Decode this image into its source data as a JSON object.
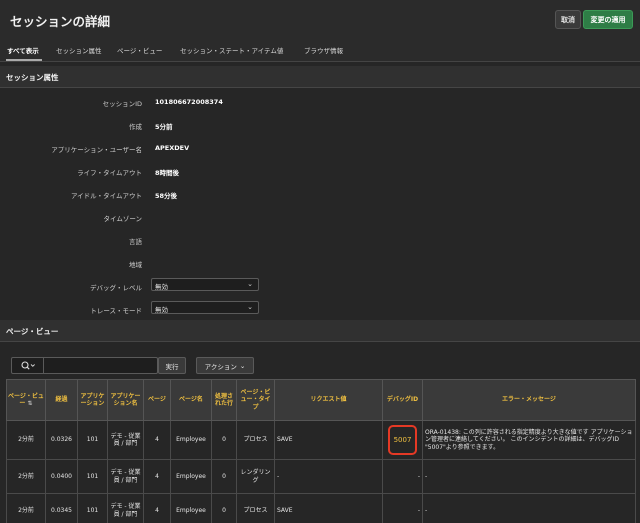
{
  "header": {
    "title": "セッションの詳細",
    "cancel_label": "取消",
    "apply_label": "変更の適用"
  },
  "tabs": [
    {
      "label": "すべて表示"
    },
    {
      "label": "セッション属性"
    },
    {
      "label": "ページ・ビュー"
    },
    {
      "label": "セッション・ステート・アイテム値"
    },
    {
      "label": "ブラウザ情報"
    }
  ],
  "session": {
    "section_title": "セッション属性",
    "attributes": [
      {
        "label": "セッションID",
        "value": "101806672008374"
      },
      {
        "label": "作成",
        "value": "5分前"
      },
      {
        "label": "アプリケーション・ユーザー名",
        "value": "APEXDEV"
      },
      {
        "label": "ライフ・タイムアウト",
        "value": "8時間後"
      },
      {
        "label": "アイドル・タイムアウト",
        "value": "58分後"
      },
      {
        "label": "タイムゾーン",
        "value": ""
      },
      {
        "label": "言語",
        "value": ""
      },
      {
        "label": "地域",
        "value": ""
      }
    ],
    "debug_level": {
      "label": "デバッグ・レベル",
      "value": "無効"
    },
    "trace_mode": {
      "label": "トレース・モード",
      "value": "無効"
    }
  },
  "page_views": {
    "section_title": "ページ・ビュー",
    "search": {
      "placeholder": ""
    },
    "go_label": "実行",
    "actions_label": "アクション",
    "columns": [
      "ページ・ビュー",
      "経過",
      "アプリケーション",
      "アプリケーション名",
      "ページ",
      "ページ名",
      "処理された行",
      "ページ・ビュー・タイプ",
      "リクエスト値",
      "デバッグID",
      "エラー・メッセージ"
    ],
    "rows": [
      {
        "view": "2分前",
        "elapsed": "0.0326",
        "app": "101",
        "app_name": "デモ - 従業員 / 部門",
        "page": "4",
        "page_name": "Employee",
        "rows": "0",
        "type": "プロセス",
        "request": "SAVE",
        "debug": "5007",
        "error": "ORA-01438: この列に許容される指定精度より大きな値です アプリケーション管理者に連絡してください。 このインシデントの詳細は、デバッグID \"5007\"より参照できます。"
      },
      {
        "view": "2分前",
        "elapsed": "0.0400",
        "app": "101",
        "app_name": "デモ - 従業員 / 部門",
        "page": "4",
        "page_name": "Employee",
        "rows": "0",
        "type": "レンダリング",
        "request": "-",
        "debug": "-",
        "error": "-"
      },
      {
        "view": "2分前",
        "elapsed": "0.0345",
        "app": "101",
        "app_name": "デモ - 従業員 / 部門",
        "page": "4",
        "page_name": "Employee",
        "rows": "0",
        "type": "プロセス",
        "request": "SAVE",
        "debug": "-",
        "error": "-"
      }
    ]
  },
  "icons": {
    "search": "search-icon",
    "chevron": "chevron-down-icon",
    "sort": "sort-icon"
  }
}
